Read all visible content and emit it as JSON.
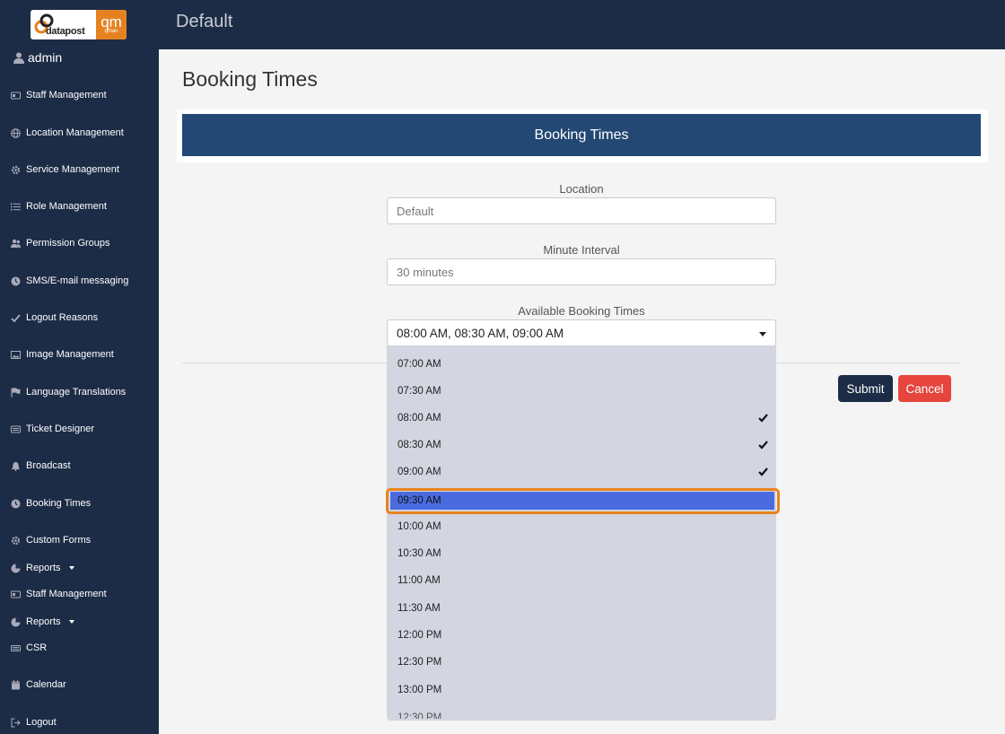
{
  "sidebar": {
    "logo": {
      "word": "datapost",
      "qm": "qm",
      "sub": "qman"
    },
    "user": "admin",
    "items": [
      {
        "label": "Staff Management",
        "icon": "id-card-icon"
      },
      {
        "label": "Location Management",
        "icon": "globe-icon"
      },
      {
        "label": "Service Management",
        "icon": "gear-icon"
      },
      {
        "label": "Role Management",
        "icon": "list-icon"
      },
      {
        "label": "Permission Groups",
        "icon": "users-icon"
      },
      {
        "label": "SMS/E-mail messaging",
        "icon": "clock-icon"
      },
      {
        "label": "Logout Reasons",
        "icon": "check-icon"
      },
      {
        "label": "Image Management",
        "icon": "image-icon"
      },
      {
        "label": "Language Translations",
        "icon": "flag-icon"
      },
      {
        "label": "Ticket Designer",
        "icon": "ticket-icon"
      },
      {
        "label": "Broadcast",
        "icon": "bell-icon"
      },
      {
        "label": "Booking Times",
        "icon": "clock-icon"
      },
      {
        "label": "Custom Forms",
        "icon": "gear-icon"
      },
      {
        "label": "Reports",
        "icon": "pie-chart-icon"
      },
      {
        "label": "Staff Management",
        "icon": "id-card-icon"
      },
      {
        "label": "Reports",
        "icon": "pie-chart-icon"
      },
      {
        "label": "CSR",
        "icon": "keyboard-icon"
      },
      {
        "label": "Calendar",
        "icon": "calendar-icon"
      },
      {
        "label": "Logout",
        "icon": "sign-out-icon"
      }
    ]
  },
  "topbar": {
    "title": "Default"
  },
  "main": {
    "page_title": "Booking Times",
    "card_title": "Booking Times",
    "location": {
      "label": "Location",
      "value": "Default"
    },
    "interval": {
      "label": "Minute Interval",
      "value": "30 minutes"
    },
    "times": {
      "label": "Available Booking Times",
      "value": "08:00 AM, 08:30 AM, 09:00 AM"
    },
    "submit_label": "Submit",
    "cancel_label": "Cancel"
  },
  "dropdown": {
    "options": [
      {
        "label": "07:00 AM",
        "checked": false
      },
      {
        "label": "07:30 AM",
        "checked": false
      },
      {
        "label": "08:00 AM",
        "checked": true
      },
      {
        "label": "08:30 AM",
        "checked": true
      },
      {
        "label": "09:00 AM",
        "checked": true
      },
      {
        "label": "09:30 AM",
        "checked": false,
        "highlighted": true
      },
      {
        "label": "10:00 AM",
        "checked": false
      },
      {
        "label": "10:30 AM",
        "checked": false
      },
      {
        "label": "11:00 AM",
        "checked": false
      },
      {
        "label": "11:30 AM",
        "checked": false
      },
      {
        "label": "12:00 PM",
        "checked": false
      },
      {
        "label": "12:30 PM",
        "checked": false
      },
      {
        "label": "13:00 PM",
        "checked": false
      }
    ]
  },
  "colors": {
    "sidebar_bg": "#1c2c46",
    "card_header_bg": "#234874",
    "submit_bg": "#1c2c46",
    "cancel_bg": "#e5453d",
    "highlight_bg": "#4a6be0",
    "highlight_ring": "#e8841d",
    "logo_orange": "#e5821f"
  }
}
